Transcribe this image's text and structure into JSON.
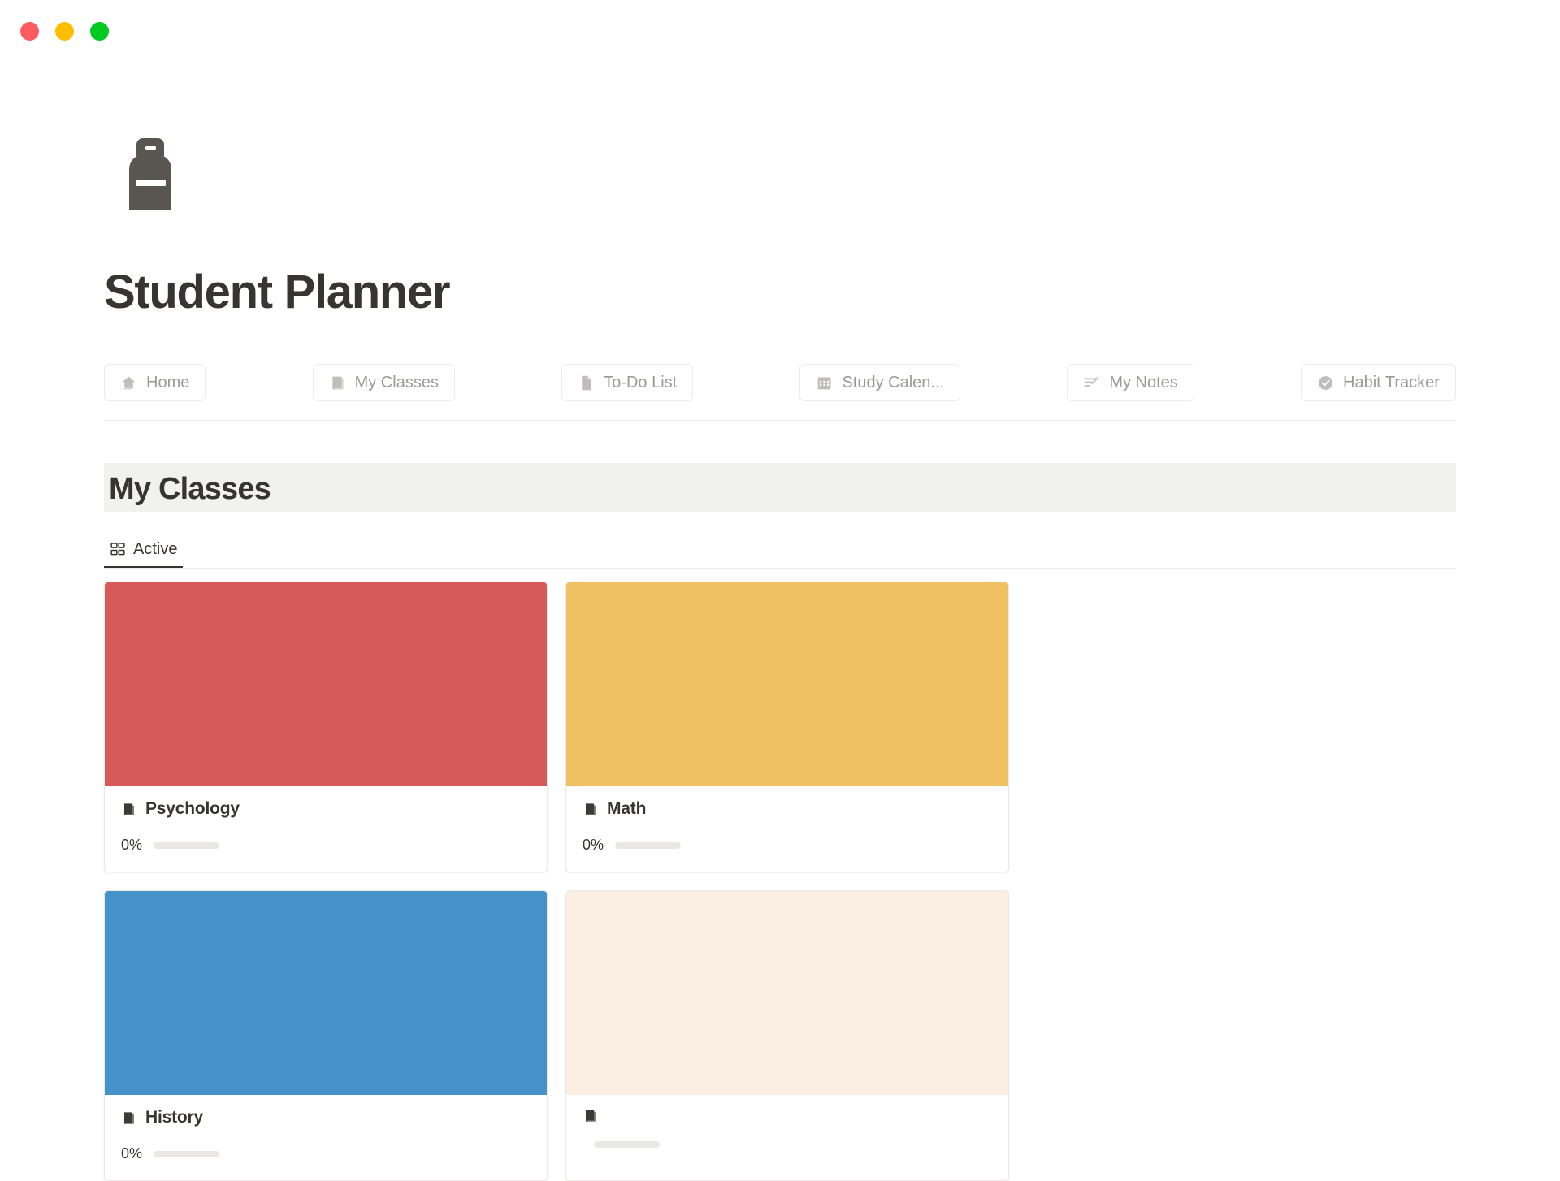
{
  "window": {
    "traffic_lights": [
      {
        "name": "close",
        "color": "#FF5A5F"
      },
      {
        "name": "minimize",
        "color": "#FFBD00"
      },
      {
        "name": "maximize",
        "color": "#00CA1F"
      }
    ]
  },
  "header": {
    "icon": "backpack-icon",
    "title": "Student Planner"
  },
  "nav": {
    "tabs": [
      {
        "label": "Home",
        "icon": "home-icon"
      },
      {
        "label": "My Classes",
        "icon": "book-icon"
      },
      {
        "label": "To-Do List",
        "icon": "document-icon"
      },
      {
        "label": "Study Calen...",
        "icon": "calendar-icon"
      },
      {
        "label": "My Notes",
        "icon": "notes-pencil-icon"
      },
      {
        "label": "Habit Tracker",
        "icon": "check-circle-icon"
      }
    ]
  },
  "section": {
    "title": "My Classes",
    "band_color": "#F1F1EF",
    "view_tabs": [
      {
        "label": "Active",
        "icon": "gallery-grid-icon",
        "selected": true
      }
    ]
  },
  "classes": [
    {
      "name": "Psychology",
      "icon": "book-icon",
      "cover_color": "#D75A5B",
      "progress_label": "0%",
      "progress_value": 0
    },
    {
      "name": "Math",
      "icon": "book-icon",
      "cover_color": "#EFC163",
      "progress_label": "0%",
      "progress_value": 0
    },
    {
      "name": "History",
      "icon": "book-icon",
      "cover_color": "#4592CB",
      "progress_label": "0%",
      "progress_value": 0
    },
    {
      "name": "",
      "icon": "book-icon",
      "cover_color": "#FBEFE4",
      "progress_label": "",
      "progress_value": 0
    }
  ],
  "colors": {
    "text_primary": "#37352F",
    "text_muted": "#9B9A97",
    "border": "#EDECEA",
    "band": "#F1F1EF",
    "track": "#E9E8E5"
  }
}
